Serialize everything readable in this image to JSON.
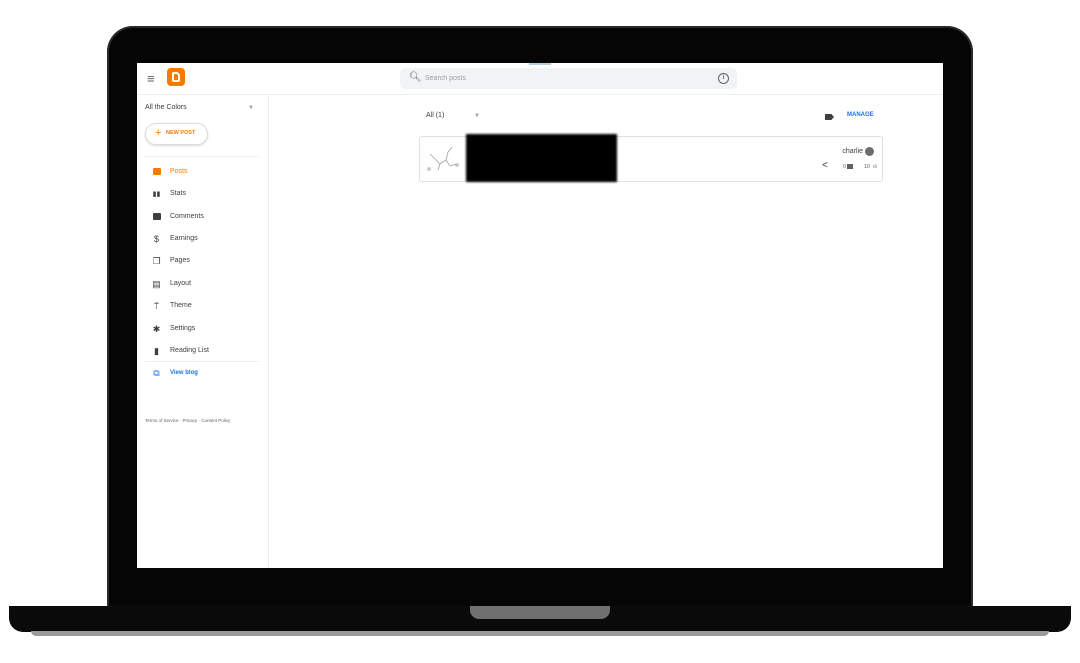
{
  "search": {
    "placeholder": "Search posts"
  },
  "sidebar": {
    "blog_name": "All the Colors",
    "new_post_label": "NEW POST",
    "items": [
      {
        "label": "Posts",
        "icon": "posts-icon"
      },
      {
        "label": "Stats",
        "icon": "stats-icon"
      },
      {
        "label": "Comments",
        "icon": "comments-icon"
      },
      {
        "label": "Earnings",
        "icon": "dollar-icon"
      },
      {
        "label": "Pages",
        "icon": "pages-icon"
      },
      {
        "label": "Layout",
        "icon": "layout-icon"
      },
      {
        "label": "Theme",
        "icon": "paint-roller-icon"
      },
      {
        "label": "Settings",
        "icon": "gear-icon"
      },
      {
        "label": "Reading List",
        "icon": "bookmark-icon"
      }
    ],
    "view_blog_label": "View blog",
    "footer": "Terms of Service · Privacy · Content Policy"
  },
  "main": {
    "filter_label": "All (1)",
    "manage_label": "MANAGE",
    "post": {
      "author": "charlie",
      "comments": "0",
      "views": "10"
    }
  },
  "colors": {
    "accent": "#f57c00",
    "link": "#1a73e8"
  }
}
